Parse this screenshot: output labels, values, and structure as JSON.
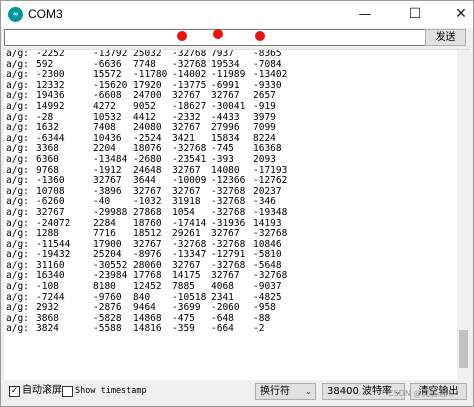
{
  "window": {
    "app_icon_label": "∞",
    "title": "COM3",
    "minimize_glyph": "—",
    "maximize_glyph": "☐",
    "close_glyph": "✕"
  },
  "send_bar": {
    "input_value": "",
    "send_label": "发送"
  },
  "annotation_color": "#ee1111",
  "monitor": {
    "rows": [
      [
        "a/g:",
        "-2252",
        "-13792",
        "25032",
        "-32768",
        "7937",
        "-8365"
      ],
      [
        "a/g:",
        "592",
        "-6636",
        "7748",
        "-32768",
        "19534",
        "-7084"
      ],
      [
        "a/g:",
        "-2300",
        "15572",
        "-11780",
        "-14002",
        "-11989",
        "-13402"
      ],
      [
        "a/g:",
        "12332",
        "-15620",
        "17920",
        "-13775",
        "-6991",
        "-9330"
      ],
      [
        "a/g:",
        "19436",
        "-6608",
        "24700",
        "32767",
        "32767",
        "2657"
      ],
      [
        "a/g:",
        "14992",
        "4272",
        "9052",
        "-18627",
        "-30041",
        "-919"
      ],
      [
        "a/g:",
        "-28",
        "10532",
        "4412",
        "-2332",
        "-4433",
        "3979"
      ],
      [
        "a/g:",
        "1632",
        "7408",
        "24080",
        "32767",
        "27996",
        "7099"
      ],
      [
        "a/g:",
        "-6344",
        "10436",
        "-2524",
        "3421",
        "15834",
        "8224"
      ],
      [
        "a/g:",
        "3368",
        "2204",
        "18076",
        "-32768",
        "-745",
        "16368"
      ],
      [
        "a/g:",
        "6360",
        "-13484",
        "-2680",
        "-23541",
        "-393",
        "2093"
      ],
      [
        "a/g:",
        "9768",
        "-1912",
        "24648",
        "32767",
        "14080",
        "-17193"
      ],
      [
        "a/g:",
        "-1360",
        "32767",
        "3644",
        "-10009",
        "-12366",
        "-12762"
      ],
      [
        "a/g:",
        "10708",
        "-3896",
        "32767",
        "32767",
        "-32768",
        "20237"
      ],
      [
        "a/g:",
        "-6260",
        "-40",
        "-1032",
        "31918",
        "-32768",
        "-346"
      ],
      [
        "a/g:",
        "32767",
        "-29988",
        "27868",
        "1054",
        "-32768",
        "-19348"
      ],
      [
        "a/g:",
        "-24072",
        "2284",
        "18760",
        "-17414",
        "-31936",
        "14193"
      ],
      [
        "a/g:",
        "1288",
        "7716",
        "18512",
        "29261",
        "32767",
        "-32768"
      ],
      [
        "a/g:",
        "-11544",
        "17900",
        "32767",
        "-32768",
        "-32768",
        "10846"
      ],
      [
        "a/g:",
        "-19432",
        "25204",
        "-8976",
        "-13347",
        "-12791",
        "-5810"
      ],
      [
        "a/g:",
        "31160",
        "-30552",
        "28060",
        "32767",
        "-32768",
        "-5648"
      ],
      [
        "a/g:",
        "16340",
        "-23984",
        "17768",
        "14175",
        "32767",
        "-32768"
      ],
      [
        "a/g:",
        "-108",
        "8180",
        "12452",
        "7885",
        "4068",
        "-9037"
      ],
      [
        "a/g:",
        "-7244",
        "-9760",
        "840",
        "-10518",
        "2341",
        "-4825"
      ],
      [
        "a/g:",
        "2932",
        "-2876",
        "9464",
        "-3699",
        "-2060",
        "-958"
      ],
      [
        "a/g:",
        "3868",
        "-5828",
        "14868",
        "-475",
        "-648",
        "-88"
      ],
      [
        "a/g:",
        "3824",
        "-5588",
        "14816",
        "-359",
        "-664",
        "-2"
      ]
    ]
  },
  "footer": {
    "autoscroll_label": "自动滚屏",
    "autoscroll_checked": true,
    "autoscroll_mark": "✓",
    "timestamp_label": "Show timestamp",
    "timestamp_checked": false,
    "line_ending_value": "换行符",
    "baud_value": "38400 波特率",
    "clear_label": "清空输出",
    "chevron_glyph": "⌄"
  },
  "watermark": "CSDN @流觞浩川"
}
